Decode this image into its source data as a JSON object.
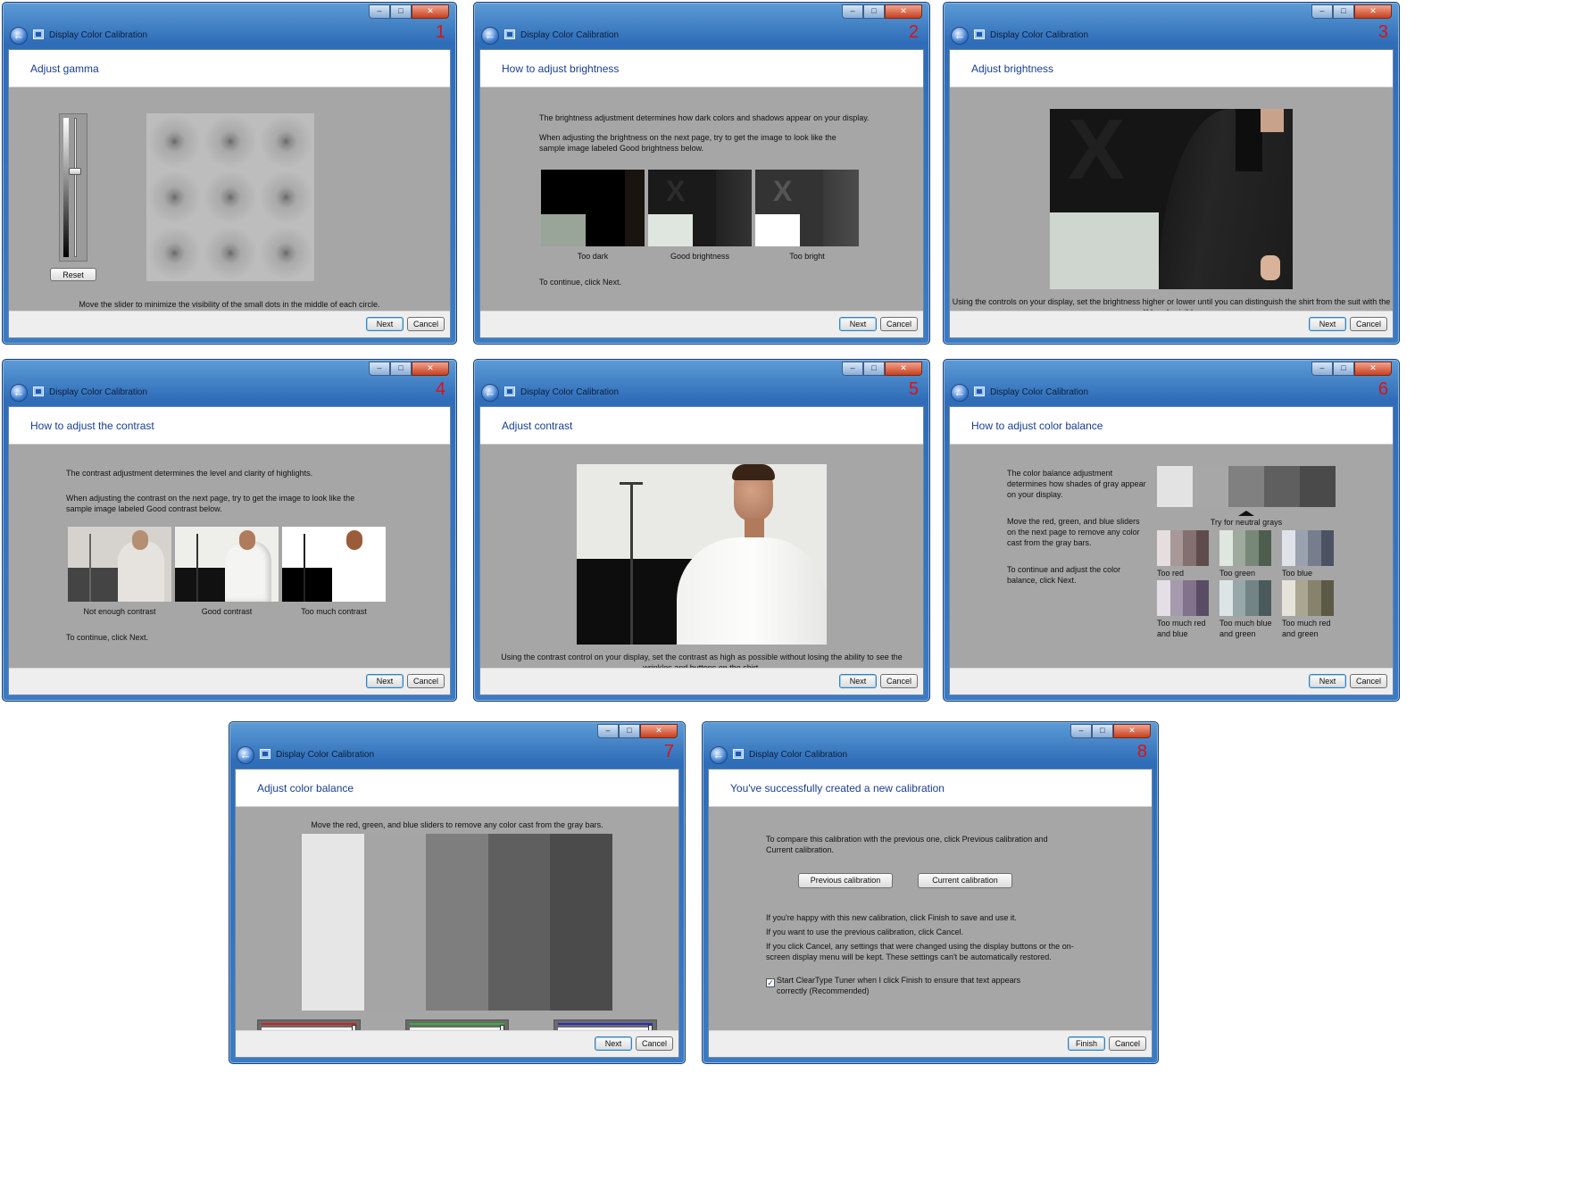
{
  "window_title": "Display Color Calibration",
  "steps": [
    {
      "number": "1",
      "header": "Adjust gamma",
      "reset_label": "Reset",
      "instruction": "Move the slider to minimize the visibility of the small dots in the middle of each circle.",
      "slider_level": 0.62,
      "next_label": "Next",
      "cancel_label": "Cancel"
    },
    {
      "number": "2",
      "header": "How to adjust brightness",
      "para1": "The brightness adjustment determines how dark colors and shadows appear on your display.",
      "para2": "When adjusting the brightness on the next page, try to get the image to look like the sample image labeled Good brightness below.",
      "samples": [
        "Too dark",
        "Good brightness",
        "Too bright"
      ],
      "continue_text": "To continue, click Next.",
      "next_label": "Next",
      "cancel_label": "Cancel"
    },
    {
      "number": "3",
      "header": "Adjust brightness",
      "instruction": "Using the controls on your display, set the brightness higher or lower until you can distinguish the shirt from the suit with the X barely visible.",
      "next_label": "Next",
      "cancel_label": "Cancel"
    },
    {
      "number": "4",
      "header": "How to adjust the contrast",
      "para1": "The contrast adjustment determines the level and clarity of highlights.",
      "para2": "When adjusting the contrast on the next page, try to get the image to look like the sample image labeled Good contrast below.",
      "samples": [
        "Not enough contrast",
        "Good contrast",
        "Too much contrast"
      ],
      "continue_text": "To continue, click Next.",
      "next_label": "Next",
      "cancel_label": "Cancel"
    },
    {
      "number": "5",
      "header": "Adjust contrast",
      "instruction": "Using the contrast control on your display, set the contrast as high as possible without losing the ability to see the wrinkles and buttons on the shirt.",
      "next_label": "Next",
      "cancel_label": "Cancel"
    },
    {
      "number": "6",
      "header": "How to adjust color balance",
      "para1": "The color balance adjustment determines how shades of gray appear on your display.",
      "para2": "Move the red, green, and blue sliders on the next page to remove any color cast from the gray bars.",
      "para3": "To continue and adjust the color balance, click Next.",
      "neutral_label": "Try for neutral grays",
      "swatches": [
        "Too red",
        "Too green",
        "Too blue",
        "Too much red and blue",
        "Too much blue and green",
        "Too much red and green"
      ],
      "next_label": "Next",
      "cancel_label": "Cancel"
    },
    {
      "number": "7",
      "header": "Adjust color balance",
      "instruction": "Move the red, green, and blue sliders to remove any color cast from the gray bars.",
      "next_label": "Next",
      "cancel_label": "Cancel"
    },
    {
      "number": "8",
      "header": "You've successfully created a new calibration",
      "para1": "To compare this calibration with the previous one, click Previous calibration and Current calibration.",
      "previous_label": "Previous calibration",
      "current_label": "Current calibration",
      "para2": "If you're happy with this new calibration, click Finish to save and use it.",
      "para3": "If you want to use the previous calibration, click Cancel.",
      "para4": "If you click Cancel, any settings that were changed using the display buttons or the on-screen display menu will be kept. These settings can't be automatically restored.",
      "cleartype_label": "Start ClearType Tuner when I click Finish to ensure that text appears correctly (Recommended)",
      "cleartype_checked": true,
      "finish_label": "Finish",
      "cancel_label": "Cancel"
    }
  ],
  "colors": {
    "title_blue": "#1a3d8f",
    "step_number_red": "#e01010",
    "client_gray": "#a6a6a6",
    "slider_red": "#d42020",
    "slider_green": "#2fb52f",
    "slider_blue": "#2a2ad0"
  }
}
